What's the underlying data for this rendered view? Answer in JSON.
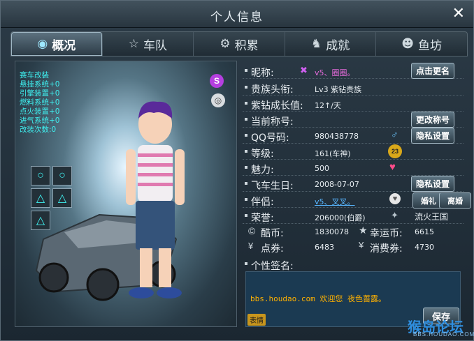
{
  "window": {
    "title": "个人信息"
  },
  "tabs": [
    {
      "label": "概况",
      "icon": "overview-icon"
    },
    {
      "label": "车队",
      "icon": "star-icon"
    },
    {
      "label": "积累",
      "icon": "gear-icon"
    },
    {
      "label": "成就",
      "icon": "achievement-icon"
    },
    {
      "label": "鱼坊",
      "icon": "fish-icon"
    }
  ],
  "left_panel": {
    "mods": [
      "赛车改装",
      "悬挂系统+0",
      "引擎装置+0",
      "燃料系统+0",
      "点火装置+0",
      "进气系统+0",
      "改装次数:0"
    ],
    "slot_symbols": [
      "○",
      "○",
      "△",
      "△",
      "△"
    ]
  },
  "profile": {
    "nickname_label": "昵称:",
    "nickname_value": "v5、圈圈。",
    "rename_button": "点击更名",
    "noble_label": "贵族头衔:",
    "noble_value": "Lv3 紫钻贵族",
    "growth_label": "紫钻成长值:",
    "growth_value": "12↑/天",
    "title_label": "当前称号:",
    "change_title_button": "更改称号",
    "qq_label": "QQ号码:",
    "qq_value": "980438778",
    "privacy_button": "隐私设置",
    "level_label": "等级:",
    "level_value": "161(车神)",
    "level_badge": "23",
    "charm_label": "魅力:",
    "charm_value": "500",
    "birthday_label": "飞车生日:",
    "birthday_value": "2008-07-07",
    "privacy_button_2": "隐私设置",
    "partner_label": "伴侣:",
    "partner_value": "v5、叉叉。",
    "wedding_button": "婚礼",
    "divorce_button": "离婚",
    "honor_label": "荣誉:",
    "honor_value": "206000(伯爵)",
    "honor_city": "流火王国",
    "coolcoin_label": "酷币:",
    "coolcoin_value": "1830078",
    "lucky_label": "幸运币:",
    "lucky_value": "6615",
    "voucher_label": "点券:",
    "voucher_value": "6483",
    "consume_label": "消费券:",
    "consume_value": "4730",
    "signature_label": "个性签名:",
    "signature_text": "bbs.houdao.com 欢迎您  夜色蔷露。",
    "emoji_button": "表情",
    "save_button": "保存"
  },
  "watermark": {
    "text": "猴岛论坛",
    "url": "BBS.HOUDAO.COM"
  }
}
